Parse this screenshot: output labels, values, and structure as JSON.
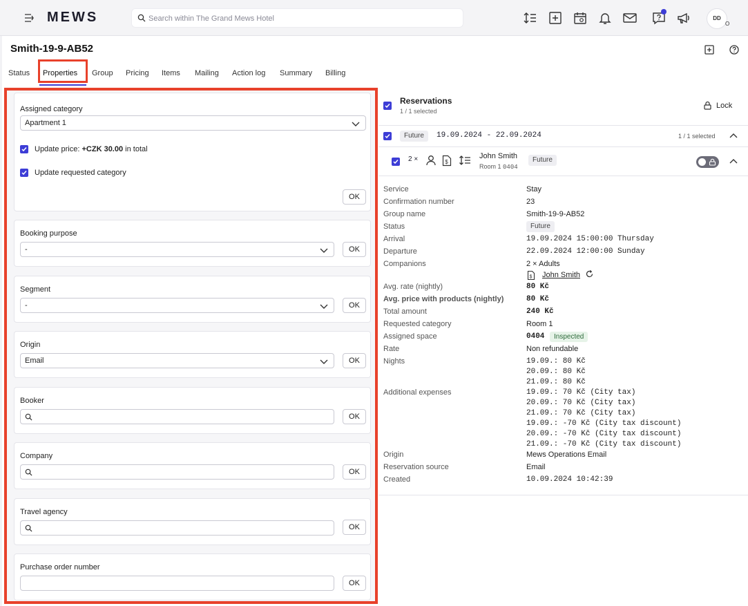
{
  "topbar": {
    "logo": "MEWS",
    "search_placeholder": "Search within The Grand Mews Hotel",
    "icons": [
      "menu-toggle-icon",
      "search-icon",
      "sort-icon",
      "add-icon",
      "calendar-icon",
      "bell-icon",
      "mail-icon",
      "help-chat-icon",
      "megaphone-icon"
    ],
    "avatar_initials": "DD",
    "avatar_sub": "O"
  },
  "header": {
    "title": "Smith-19-9-AB52"
  },
  "tabs": [
    "Status",
    "Properties",
    "Group",
    "Pricing",
    "Items",
    "Mailing",
    "Action log",
    "Summary",
    "Billing"
  ],
  "active_tab": "Properties",
  "properties": {
    "assigned_category": {
      "label": "Assigned category",
      "value": "Apartment 1",
      "update_price_prefix": "Update price: ",
      "update_price_amount": "+CZK 30.00",
      "update_price_suffix": " in total",
      "update_price_checked": true,
      "update_requested_label": "Update requested category",
      "update_requested_checked": true,
      "ok": "OK"
    },
    "booking_purpose": {
      "label": "Booking purpose",
      "value": "-",
      "ok": "OK"
    },
    "segment": {
      "label": "Segment",
      "value": "-",
      "ok": "OK"
    },
    "origin": {
      "label": "Origin",
      "value": "Email",
      "ok": "OK"
    },
    "booker": {
      "label": "Booker",
      "value": "",
      "ok": "OK"
    },
    "company": {
      "label": "Company",
      "value": "",
      "ok": "OK"
    },
    "travel_agency": {
      "label": "Travel agency",
      "value": "",
      "ok": "OK"
    },
    "purchase_order": {
      "label": "Purchase order number",
      "value": "",
      "ok": "OK"
    }
  },
  "reservations": {
    "title": "Reservations",
    "selected": "1 / 1 selected",
    "lock_label": "Lock",
    "group_status": "Future",
    "group_dates": "19.09.2024 - 22.09.2024",
    "group_selected": "1 / 1 selected",
    "item": {
      "count": "2 ×",
      "guest_name": "John Smith",
      "room_prefix": "Room 1",
      "room_number": "0404",
      "status": "Future"
    },
    "details": {
      "service": {
        "label": "Service",
        "value": "Stay"
      },
      "confirmation": {
        "label": "Confirmation number",
        "value": "23"
      },
      "group_name": {
        "label": "Group name",
        "value": "Smith-19-9-AB52"
      },
      "status": {
        "label": "Status",
        "value": "Future"
      },
      "arrival": {
        "label": "Arrival",
        "value": "19.09.2024 15:00:00 Thursday"
      },
      "departure": {
        "label": "Departure",
        "value": "22.09.2024 12:00:00 Sunday"
      },
      "companions": {
        "label": "Companions",
        "value": "2 × Adults",
        "guest": "John Smith"
      },
      "avg_rate": {
        "label": "Avg. rate (nightly)",
        "value": "80 Kč"
      },
      "avg_price_products": {
        "label": "Avg. price with products (nightly)",
        "value": "80 Kč"
      },
      "total_amount": {
        "label": "Total amount",
        "value": "240 Kč"
      },
      "requested_category": {
        "label": "Requested category",
        "value": "Room 1"
      },
      "assigned_space": {
        "label": "Assigned space",
        "value": "0404",
        "state": "Inspected"
      },
      "rate": {
        "label": "Rate",
        "value": "Non refundable"
      },
      "nights": {
        "label": "Nights",
        "values": [
          "19.09.: 80 Kč",
          "20.09.: 80 Kč",
          "21.09.: 80 Kč"
        ]
      },
      "additional_expenses": {
        "label": "Additional expenses",
        "values": [
          "19.09.: 70 Kč (City tax)",
          "20.09.: 70 Kč (City tax)",
          "21.09.: 70 Kč (City tax)",
          "19.09.: -70 Kč (City tax discount)",
          "20.09.: -70 Kč (City tax discount)",
          "21.09.: -70 Kč (City tax discount)"
        ]
      },
      "origin": {
        "label": "Origin",
        "value": "Mews Operations Email"
      },
      "reservation_source": {
        "label": "Reservation source",
        "value": "Email"
      },
      "created": {
        "label": "Created",
        "value": "10.09.2024 10:42:39"
      }
    }
  }
}
